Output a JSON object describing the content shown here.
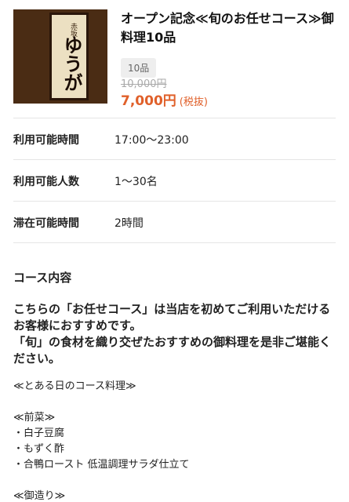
{
  "header": {
    "sign_small": "赤坂",
    "sign_main": "ゆうが",
    "title": "オープン記念≪旬のお任せコース≫御料理10品",
    "badge": "10品",
    "price_old": "10,000円",
    "price_new": "7,000円",
    "price_tax": "(税抜)"
  },
  "info": [
    {
      "label": "利用可能時間",
      "value": "17:00〜23:00"
    },
    {
      "label": "利用可能人数",
      "value": "1〜30名"
    },
    {
      "label": "滞在可能時間",
      "value": "2時間"
    }
  ],
  "course": {
    "heading": "コース内容",
    "description": "こちらの「お任せコース」は当店を初めてご利用いただけるお客様におすすめです。\n「旬」の食材を織り交ぜたおすすめの御料理を是非ご堪能ください。",
    "sample_title": "≪とある日のコース料理≫",
    "appetizer_title": "≪前菜≫",
    "appetizers": [
      "・白子豆腐",
      "・もずく酢",
      "・合鴨ロースト 低温調理サラダ仕立て"
    ],
    "sashimi_title": "≪御造り≫"
  }
}
